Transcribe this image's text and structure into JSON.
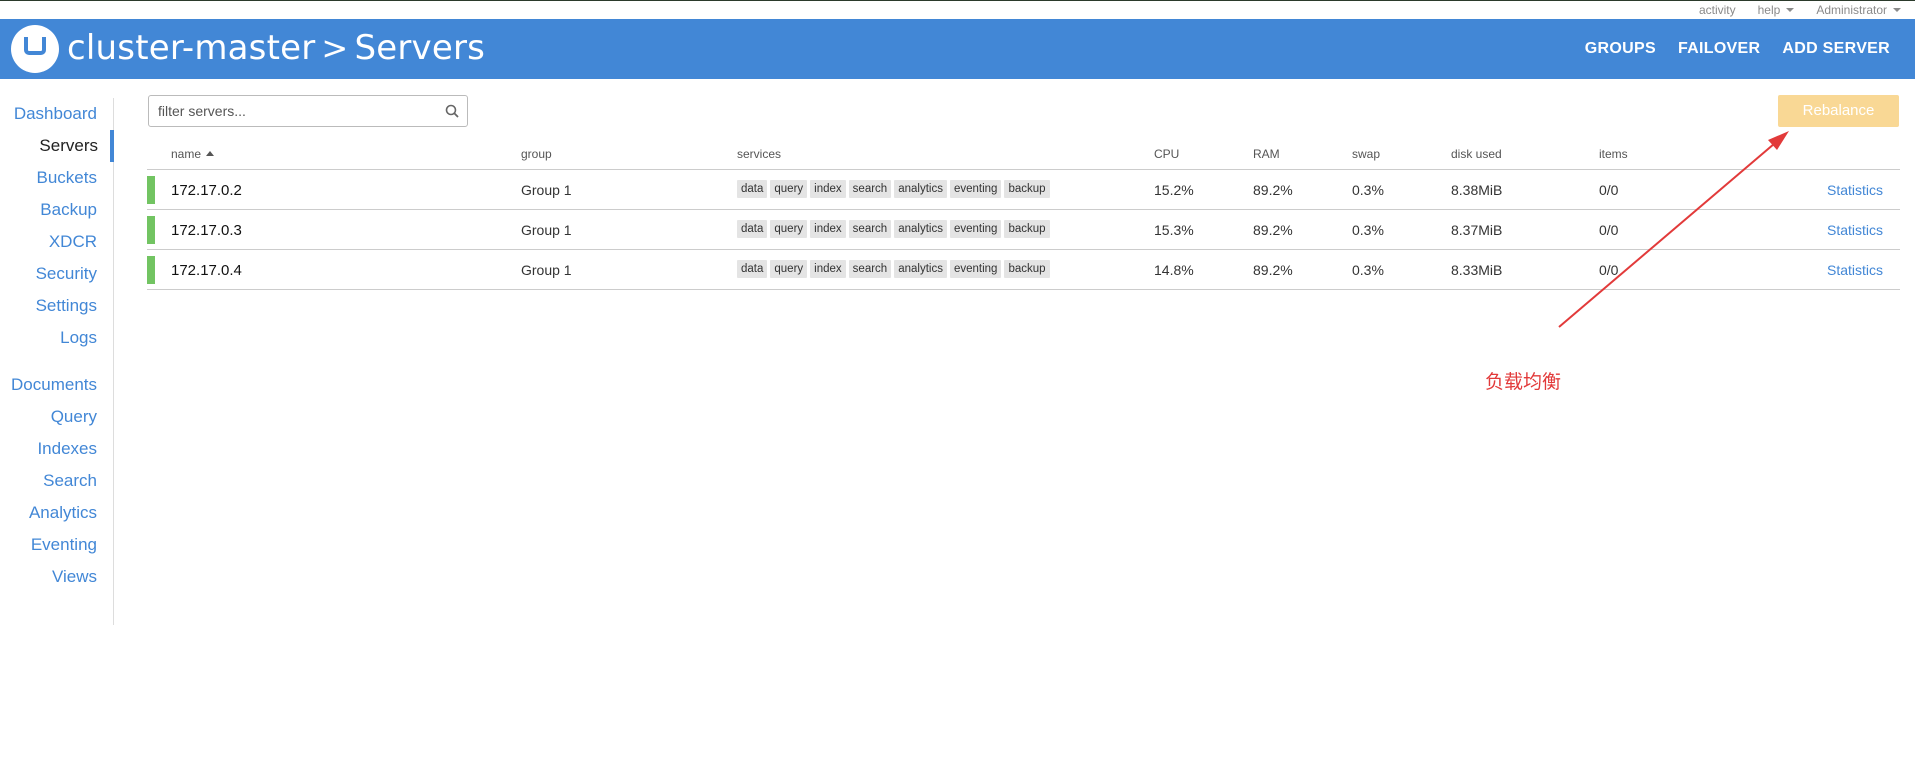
{
  "topbar": {
    "activity": "activity",
    "help": "help",
    "user": "Administrator"
  },
  "header": {
    "cluster": "cluster-master",
    "separator": ">",
    "page": "Servers",
    "nav": [
      "GROUPS",
      "FAILOVER",
      "ADD SERVER"
    ]
  },
  "sidebar": {
    "items": [
      "Dashboard",
      "Servers",
      "Buckets",
      "Backup",
      "XDCR",
      "Security",
      "Settings",
      "Logs"
    ],
    "items2": [
      "Documents",
      "Query",
      "Indexes",
      "Search",
      "Analytics",
      "Eventing",
      "Views"
    ],
    "active": "Servers"
  },
  "filter": {
    "placeholder": "filter servers..."
  },
  "rebalance_label": "Rebalance",
  "table": {
    "columns": [
      "name",
      "group",
      "services",
      "CPU",
      "RAM",
      "swap",
      "disk used",
      "items"
    ],
    "rows": [
      {
        "name": "172.17.0.2",
        "group": "Group 1",
        "services": [
          "data",
          "query",
          "index",
          "search",
          "analytics",
          "eventing",
          "backup"
        ],
        "cpu": "15.2%",
        "ram": "89.2%",
        "swap": "0.3%",
        "disk": "8.38MiB",
        "items": "0/0",
        "link": "Statistics"
      },
      {
        "name": "172.17.0.3",
        "group": "Group 1",
        "services": [
          "data",
          "query",
          "index",
          "search",
          "analytics",
          "eventing",
          "backup"
        ],
        "cpu": "15.3%",
        "ram": "89.2%",
        "swap": "0.3%",
        "disk": "8.37MiB",
        "items": "0/0",
        "link": "Statistics"
      },
      {
        "name": "172.17.0.4",
        "group": "Group 1",
        "services": [
          "data",
          "query",
          "index",
          "search",
          "analytics",
          "eventing",
          "backup"
        ],
        "cpu": "14.8%",
        "ram": "89.2%",
        "swap": "0.3%",
        "disk": "8.33MiB",
        "items": "0/0",
        "link": "Statistics"
      }
    ]
  },
  "annotation": {
    "text": "负载均衡",
    "color": "#e23a3a"
  },
  "colors": {
    "brand": "#4287d6",
    "healthy": "#72c462",
    "rebalance_disabled": "#f9d895"
  }
}
